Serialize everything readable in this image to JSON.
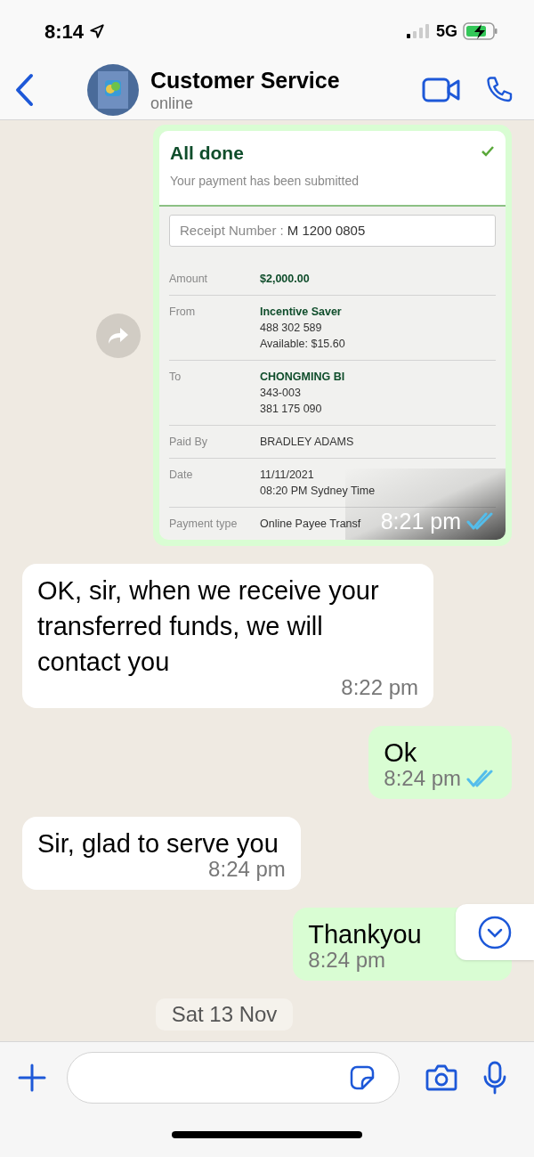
{
  "status_bar": {
    "time": "8:14",
    "network": "5G"
  },
  "header": {
    "title": "Customer Service",
    "subtitle": "online"
  },
  "messages": [
    {
      "kind": "receipt",
      "time": "8:21 pm",
      "read": true,
      "receipt": {
        "title": "All done",
        "subtitle": "Your payment has been submitted",
        "receipt_label": "Receipt Number :",
        "receipt_number": "M 1200 0805",
        "rows": [
          {
            "label": "Amount",
            "lines": [
              {
                "text": "$2,000.00",
                "bold": true
              }
            ]
          },
          {
            "label": "From",
            "lines": [
              {
                "text": "Incentive Saver",
                "bold": true
              },
              {
                "text": "488 302 589",
                "bold": false
              },
              {
                "text": "Available: $15.60",
                "bold": false
              }
            ]
          },
          {
            "label": "To",
            "lines": [
              {
                "text": "CHONGMING BI",
                "bold": true
              },
              {
                "text": "343-003",
                "bold": false
              },
              {
                "text": "381 175 090",
                "bold": false
              }
            ]
          },
          {
            "label": "Paid By",
            "lines": [
              {
                "text": "BRADLEY ADAMS",
                "bold": false
              }
            ]
          },
          {
            "label": "Date",
            "lines": [
              {
                "text": "11/11/2021",
                "bold": false
              },
              {
                "text": "08:20 PM Sydney Time",
                "bold": false
              }
            ]
          },
          {
            "label": "Payment type",
            "lines": [
              {
                "text": "Online Payee Transf",
                "bold": false
              }
            ]
          }
        ]
      }
    },
    {
      "kind": "incoming",
      "text": "OK, sir, when we receive your transferred funds, we will contact you",
      "time": "8:22 pm"
    },
    {
      "kind": "outgoing",
      "text": "Ok",
      "time": "8:24 pm",
      "read": true
    },
    {
      "kind": "incoming",
      "text": "Sir, glad to serve you",
      "time": "8:24 pm"
    },
    {
      "kind": "outgoing",
      "text": "Thankyou",
      "time": "8:24 pm"
    }
  ],
  "date_divider": "Sat 13 Nov"
}
